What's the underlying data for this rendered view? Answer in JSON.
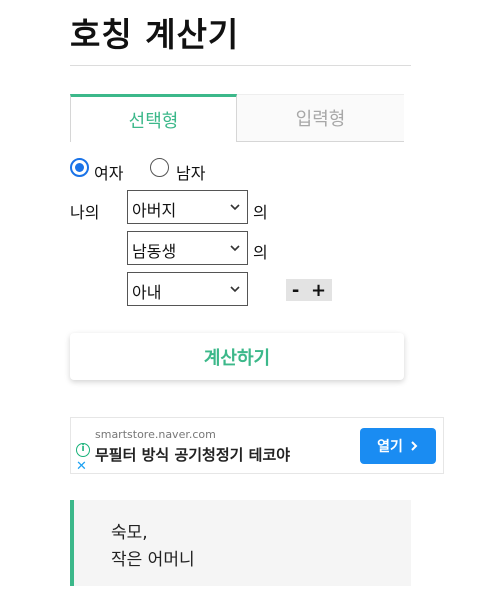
{
  "page": {
    "title": "호칭 계산기"
  },
  "tabs": [
    {
      "label": "선택형",
      "active": true
    },
    {
      "label": "입력형",
      "active": false
    }
  ],
  "gender": {
    "options": [
      {
        "label": "여자",
        "checked": true
      },
      {
        "label": "남자",
        "checked": false
      }
    ]
  },
  "relation": {
    "prefix": "나의",
    "connector": "의",
    "selects": [
      {
        "value": "아버지"
      },
      {
        "value": "남동생"
      },
      {
        "value": "아내"
      }
    ],
    "stepper": {
      "minus": "-",
      "plus": "+"
    }
  },
  "calculate": {
    "label": "계산하기"
  },
  "ad": {
    "domain": "smartstore.naver.com",
    "text": "무필터 방식 공기청정기 테코야",
    "button": "열기",
    "info_icon": "i",
    "close_icon": "✕"
  },
  "result": {
    "lines": [
      "숙모,",
      "작은 어머니"
    ]
  },
  "colors": {
    "accent": "#3cb88a",
    "radio": "#1a73e8",
    "ad_button": "#1a8cf2"
  },
  "icons": {
    "dropdown": "chevron-down-icon",
    "ad_open": "chevron-right-icon"
  }
}
